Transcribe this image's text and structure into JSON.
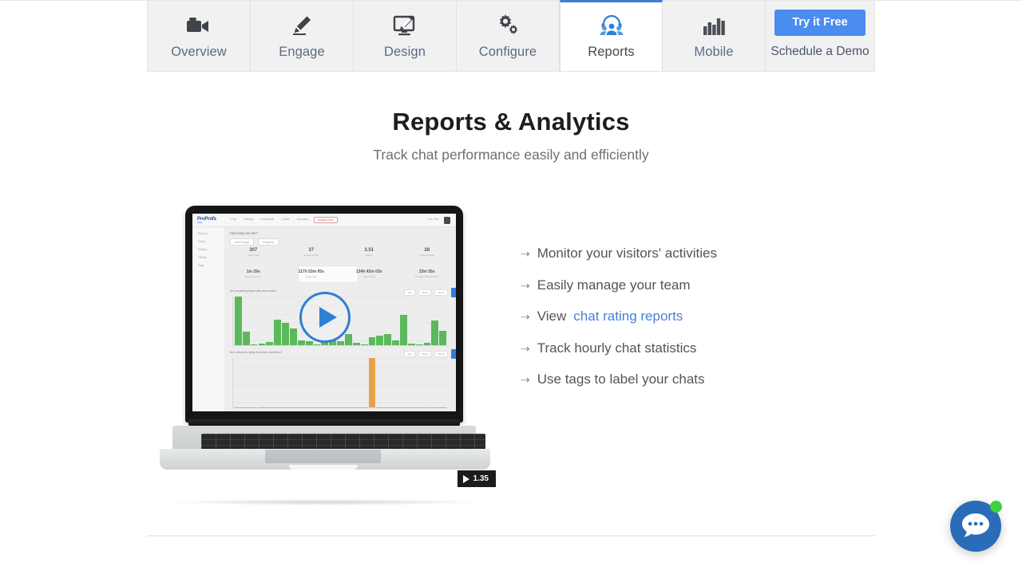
{
  "nav": {
    "tabs": [
      {
        "label": "Overview",
        "icon": "video-camera-icon",
        "active": false
      },
      {
        "label": "Engage",
        "icon": "pencil-icon",
        "active": false
      },
      {
        "label": "Design",
        "icon": "monitor-pencil-icon",
        "active": false
      },
      {
        "label": "Configure",
        "icon": "gears-icon",
        "active": false
      },
      {
        "label": "Reports",
        "icon": "people-headset-icon",
        "active": true
      },
      {
        "label": "Mobile",
        "icon": "bar-chart-icon",
        "active": false
      }
    ],
    "cta_button": "Try it Free",
    "cta_link": "Schedule a Demo",
    "active_color": "#3b7dd8",
    "button_color": "#4a8cf0"
  },
  "hero": {
    "title": "Reports & Analytics",
    "subtitle": "Track chat performance easily and efficiently"
  },
  "video": {
    "duration": "1.35",
    "play_icon": "play-triangle-icon",
    "accent_color": "#2f7fd6"
  },
  "dashboard": {
    "logo": "ProProfs",
    "logo_sub": "Chat",
    "menu": [
      "Chat",
      "Settings",
      "Downloads",
      "Create",
      "Operators",
      "Reports"
    ],
    "pill": "Upgrade Now",
    "right_text": "Live Chat",
    "title": "How busy are we?",
    "filters": [
      "Last 30 days",
      "All agents"
    ],
    "stats_row1": [
      {
        "value": "307",
        "label": "Total Chats"
      },
      {
        "value": "37",
        "label": "Missed Chats"
      },
      {
        "value": "3.51",
        "label": "Rating"
      },
      {
        "value": "28",
        "label": "Repeat Chats"
      }
    ],
    "stats_row2": [
      {
        "value": "1m 29s",
        "label": "Response Time"
      },
      {
        "value": "117h 53m 05s",
        "label": "Chat Time"
      },
      {
        "value": "134h 42m 03s",
        "label": "Total Online"
      },
      {
        "value": "23m 55s",
        "label": "Average Chat Duration"
      }
    ],
    "chart1_question": "Are we getting busier with more chats?",
    "chart2_question": "Are customers rating their chat experience?",
    "chart_buttons": [
      "Day",
      "Week",
      "Month"
    ],
    "chart1_color": "#5cb85c",
    "chart2_color": "#e8a34a",
    "chart1_values": [
      88,
      24,
      2,
      3,
      6,
      46,
      40,
      30,
      8,
      7,
      2,
      9,
      10,
      7,
      20,
      4,
      2,
      14,
      18,
      20,
      8,
      55,
      3,
      2,
      4,
      45,
      26
    ],
    "chart2_values": [
      0,
      0,
      0,
      0,
      0,
      0,
      0,
      0,
      0,
      0,
      0,
      0,
      0,
      0,
      0,
      0,
      0,
      70,
      0,
      0,
      0,
      0,
      0,
      0,
      0,
      0,
      0
    ]
  },
  "features": [
    {
      "text": "Monitor your visitors' activities",
      "link": ""
    },
    {
      "text": "Easily manage your team",
      "link": ""
    },
    {
      "text": "View ",
      "link": "chat rating reports"
    },
    {
      "text": "Track hourly chat statistics",
      "link": ""
    },
    {
      "text": "Use tags to label your chats",
      "link": ""
    }
  ],
  "chat_widget": {
    "icon": "chat-bubble-icon",
    "color": "#2b6cb8",
    "status_color": "#3ed13e"
  }
}
